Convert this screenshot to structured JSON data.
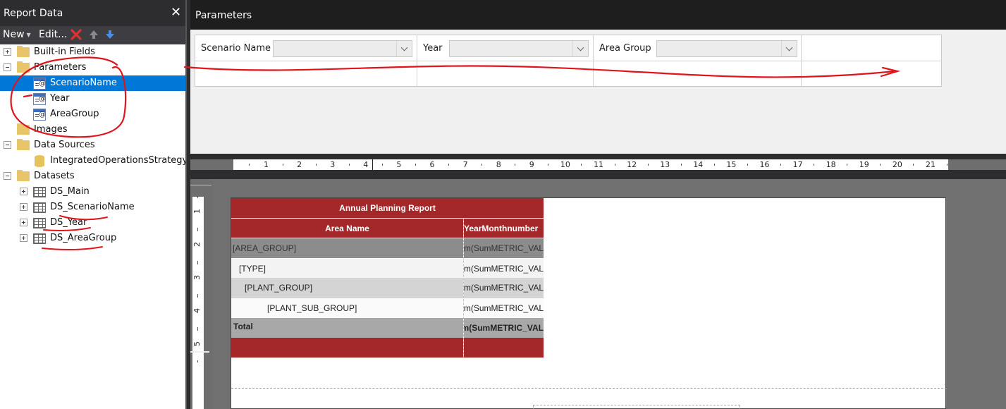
{
  "report_data": {
    "title": "Report Data",
    "close_icon": "close-icon",
    "toolbar": {
      "new_label": "New",
      "edit_label": "Edit...",
      "delete_icon": "delete-icon",
      "move_up_icon": "arrow-up-icon",
      "move_down_icon": "arrow-down-icon"
    },
    "tree": {
      "builtin_fields": "Built-in Fields",
      "parameters": "Parameters",
      "parameter_items": [
        "ScenarioName",
        "Year",
        "AreaGroup"
      ],
      "images": "Images",
      "data_sources": "Data Sources",
      "data_source_items": [
        "IntegratedOperationsStrategy_D"
      ],
      "datasets": "Datasets",
      "dataset_items": [
        "DS_Main",
        "DS_ScenarioName",
        "DS_Year",
        "DS_AreaGroup"
      ],
      "selected": "ScenarioName"
    }
  },
  "parameters_pane": {
    "title": "Parameters",
    "fields": [
      {
        "label": "Scenario Name",
        "value": ""
      },
      {
        "label": "Year",
        "value": ""
      },
      {
        "label": "Area Group",
        "value": ""
      }
    ]
  },
  "rulers": {
    "horizontal": [
      "1",
      "2",
      "3",
      "4",
      "5",
      "6",
      "7",
      "8",
      "9",
      "10",
      "11",
      "12",
      "13",
      "14",
      "15",
      "16",
      "17",
      "18",
      "19",
      "20",
      "21"
    ],
    "vertical": [
      "1",
      "2",
      "3",
      "4",
      "5"
    ]
  },
  "report": {
    "title": "Annual Planning Report",
    "header_area": "Area Name",
    "header_col": "YearMonthnumber",
    "rows": [
      {
        "label": "[AREA_GROUP]",
        "value": "Sum(SumMETRIC_VAL"
      },
      {
        "label": "[TYPE]",
        "value": "Sum(SumMETRIC_VAL"
      },
      {
        "label": "[PLANT_GROUP]",
        "value": "Sum(SumMETRIC_VAL"
      },
      {
        "label": "[PLANT_SUB_GROUP]",
        "value": "Sum(SumMETRIC_VAL"
      }
    ],
    "total_label": "Total",
    "total_value": "Sum(SumMETRIC_VAL"
  },
  "colors": {
    "accent_red": "#a4282a",
    "selection_blue": "#0078d7",
    "annotation_red": "#e0141b"
  }
}
